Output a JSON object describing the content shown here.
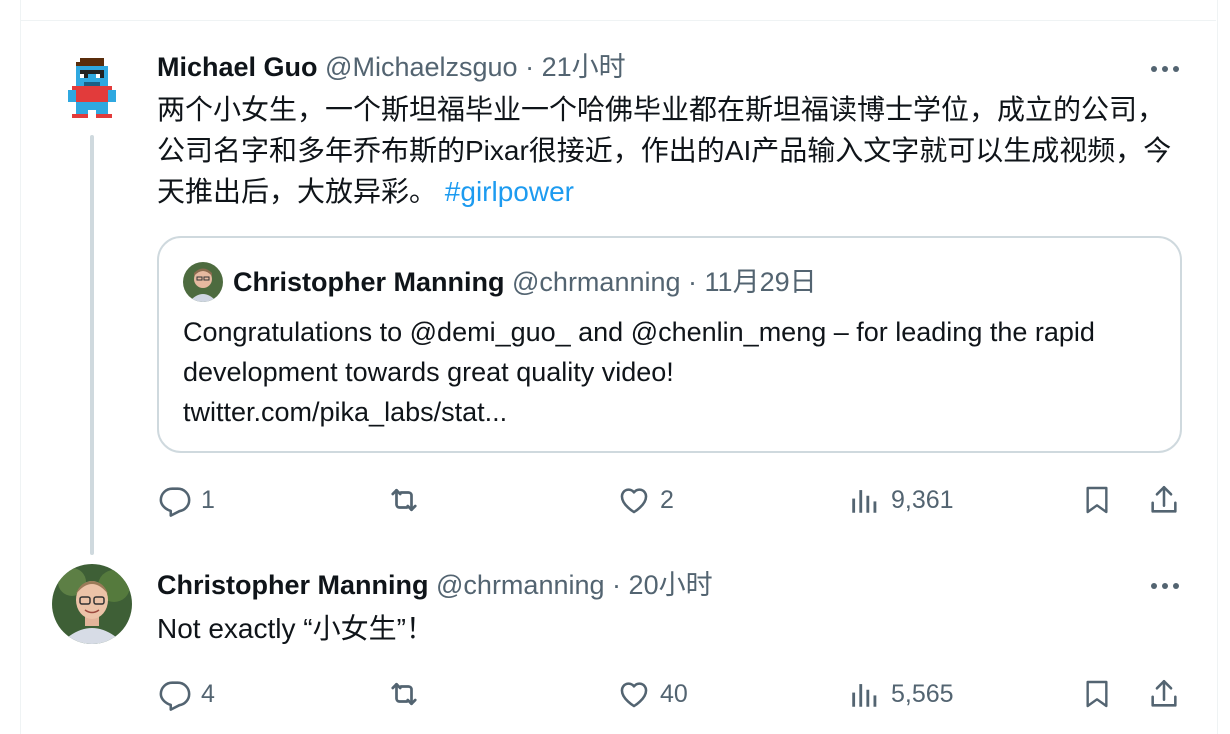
{
  "tweet1": {
    "author_name": "Michael Guo",
    "author_handle": "@Michaelzsguo",
    "separator": "·",
    "time": "21小时",
    "text_main": "两个小女生，一个斯坦福毕业一个哈佛毕业都在斯坦福读博士学位，成立的公司，公司名字和多年乔布斯的Pixar很接近，作出的AI产品输入文字就可以生成视频，今天推出后，大放异彩。",
    "hashtag": "#girlpower",
    "quote": {
      "author_name": "Christopher Manning",
      "author_handle": "@chrmanning",
      "separator": "·",
      "time": "11月29日",
      "text": "Congratulations to @demi_guo_ and @chenlin_meng – for leading the rapid development towards great quality video!",
      "link": "twitter.com/pika_labs/stat..."
    },
    "actions": {
      "replies": "1",
      "retweets": "",
      "likes": "2",
      "views": "9,361"
    }
  },
  "tweet2": {
    "author_name": "Christopher Manning",
    "author_handle": "@chrmanning",
    "separator": "·",
    "time": "20小时",
    "text": "Not exactly “小女生”！",
    "actions": {
      "replies": "4",
      "retweets": "",
      "likes": "40",
      "views": "5,565"
    }
  },
  "colors": {
    "text": "#0f1419",
    "muted": "#536471",
    "link": "#1d9bf0",
    "border": "#cfd9de"
  }
}
